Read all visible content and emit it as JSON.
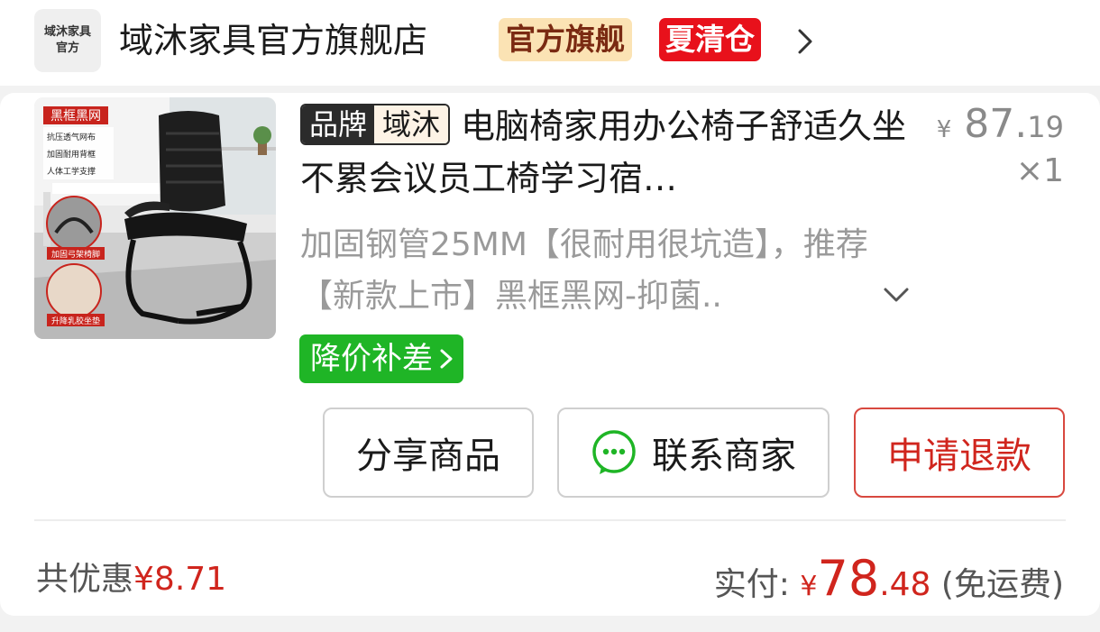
{
  "shop": {
    "logo_line1": "域沐家具",
    "logo_line2": "官方",
    "name": "域沐家具官方旗舰店",
    "badge_official": "官方旗舰",
    "badge_sale": "夏清仓"
  },
  "thumbnail": {
    "tag": "黑框黑网",
    "features": [
      "抗压透气网布",
      "加固耐用背框",
      "人体工学支撑"
    ],
    "caption_frame": "加固弓架椅脚",
    "caption_cushion": "升降乳胶坐垫"
  },
  "item": {
    "brand_key": "品牌",
    "brand_value": "域沐",
    "title": "电脑椅家用办公椅子舒适久坐不累会议员工椅学习宿…",
    "price_symbol": "¥",
    "price_int": "87.",
    "price_dec": "19",
    "quantity": "×1",
    "spec": "加固钢管25MM【很耐用很坑造】，推荐【新款上市】黑框黑网-抑菌..",
    "promo_tag": "降价补差"
  },
  "actions": {
    "share": "分享商品",
    "contact": "联系商家",
    "refund": "申请退款"
  },
  "summary": {
    "discount_label": "共优惠",
    "discount_amount": "¥8.71",
    "paid_label": "实付: ",
    "paid_symbol": "¥",
    "paid_int": "78",
    "paid_dec": ".48",
    "shipping_note": " (免运费)"
  },
  "colors": {
    "accent_red": "#d0251d",
    "promo_green": "#1fb526",
    "sale_badge": "#e8111b",
    "official_badge": "#fbe3b4"
  }
}
